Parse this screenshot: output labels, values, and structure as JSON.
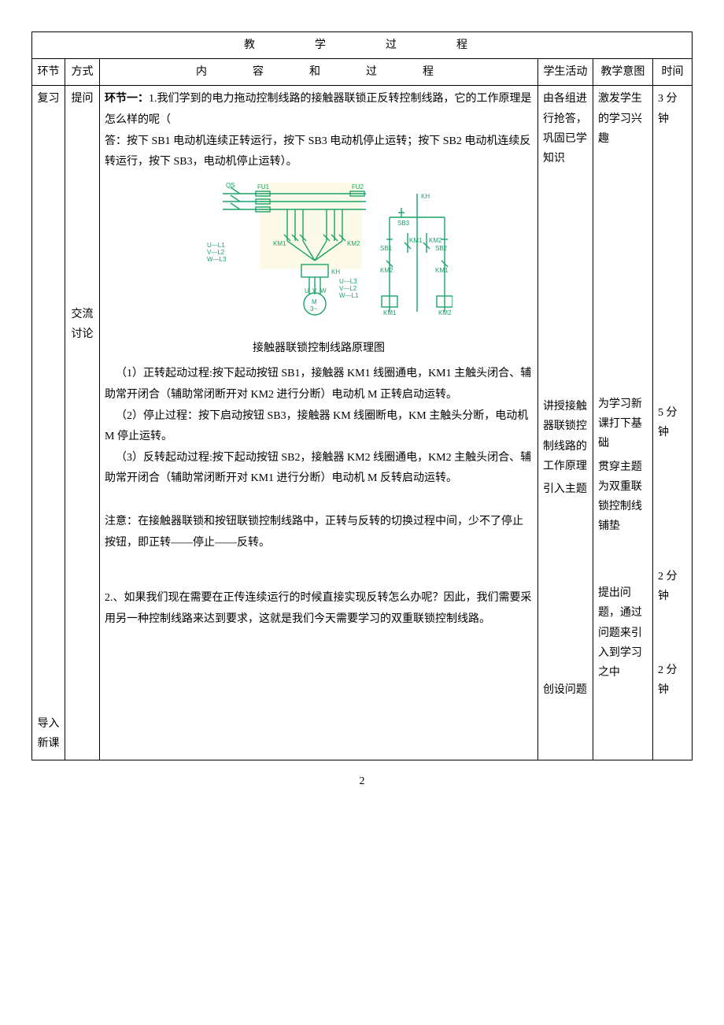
{
  "title_row": "教　　学　　过　　程",
  "headers": {
    "c1": "环节",
    "c2": "方式",
    "c3": "内　　容　　和　　过　　程",
    "c4": "学生活动",
    "c5": "教学意图",
    "c6": "时间"
  },
  "col1": {
    "fuxi": "复习",
    "daoru": "导入新课"
  },
  "col2": {
    "tiwen": "提问",
    "jiaoliu": "交流讨论"
  },
  "content": {
    "seg1_label": "环节一：",
    "seg1_q": "1.我们学到的电力拖动控制线路的接触器联锁正反转控制线路，它的工作原理是怎么样的呢（",
    "seg1_ans": "答：按下 SB1 电动机连续正转运行，按下 SB3 电动机停止运转；按下 SB2 电动机连续反转运行，按下 SB3，电动机停止运转）。",
    "diagram_caption": "接触器联锁控制线路原理图",
    "p1": "（1）正转起动过程:按下起动按钮 SB1，接触器 KM1 线圈通电，KM1 主触头闭合、辅助常开闭合（辅助常闭断开对 KM2 进行分断）电动机 M 正转启动运转。",
    "p2": "（2）停止过程：按下启动按钮 SB3，接触器 KM 线圈断电，KM 主触头分断，电动机 M 停止运转。",
    "p3": "（3）反转起动过程:按下起动按钮 SB2，接触器 KM2 线圈通电，KM2 主触头闭合、辅助常开闭合（辅助常闭断开对 KM1 进行分断）电动机 M 反转启动运转。",
    "note": "注意：在接触器联锁和按钮联锁控制线路中，正转与反转的切换过程中间，少不了停止按钮，即正转——停止——反转。",
    "q2": "2.、如果我们现在需要在正传连续运行的时候直接实现反转怎么办呢？因此，我们需要采用另一种控制线路来达到要求，这就是我们今天需要学习的双重联锁控制线路。"
  },
  "activity": {
    "a1": "由各组进行抢答，巩固已学知识",
    "a2": "讲授接触器联锁控制线路的工作原理",
    "a3": "引入主题",
    "a4": "创设问题"
  },
  "intent": {
    "i1": "激发学生的学习兴趣",
    "i2": "为学习新课打下基础",
    "i3": "贯穿主题为双重联锁控制线铺垫",
    "i4": "提出问题，通过问题来引入到学习之中"
  },
  "time": {
    "t1": "3 分钟",
    "t2": "5 分钟",
    "t3": "2 分钟",
    "t4": "2 分钟"
  },
  "diagram_labels": {
    "QS": "QS",
    "FU1": "FU1",
    "FU2": "FU2",
    "KH": "KH",
    "SB1": "SB1",
    "SB2": "SB2",
    "SB3": "SB3",
    "KM1": "KM1",
    "KM2": "KM2",
    "U": "U",
    "V": "V",
    "W": "W",
    "UL1": "U—L1",
    "VL2": "V—L2",
    "WL3": "W—L3",
    "UL3": "U—L3",
    "VL2b": "V—L2",
    "WL1": "W—L1",
    "M": "M",
    "M3": "3~"
  },
  "page_number": "2"
}
